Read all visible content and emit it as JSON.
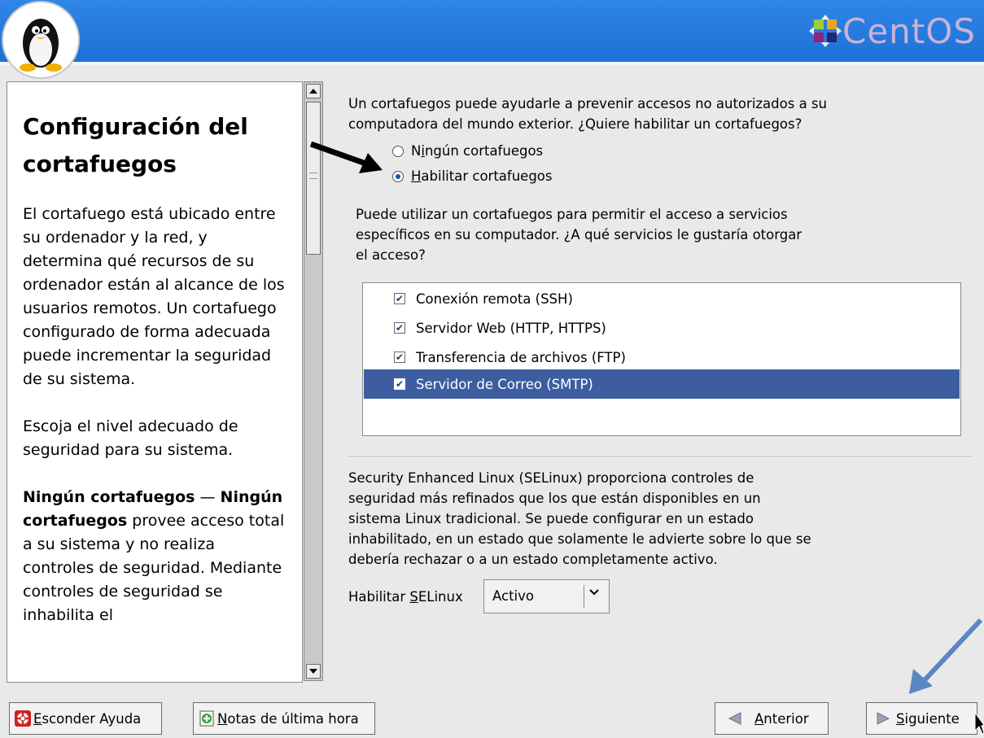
{
  "header": {
    "logo_text": "CentOS"
  },
  "help": {
    "title": "Configuración del cortafuegos",
    "p1": "El cortafuego está ubicado entre su ordenador y la red, y determina qué recursos de su ordenador están al alcance de los usuarios remotos. Un cortafuego configurado de forma adecuada puede incrementar la seguridad de su sistema.",
    "p2": "Escoja el nivel adecuado de seguridad para su sistema.",
    "p3_bold1": "Ningún cortafuegos",
    "p3_dash": " —",
    "p3_bold2": "Ningún cortafuegos",
    "p3_rest": " provee acceso total a su sistema y no realiza controles de seguridad. Mediante controles de seguridad se inhabilita el"
  },
  "firewall": {
    "intro_line1": "Un cortafuegos puede ayudarle a prevenir accesos no autorizados a su",
    "intro_line2": "computadora del mundo exterior. ¿Quiere habilitar un cortafuegos?",
    "option_none_pre": "N",
    "option_none_key": "i",
    "option_none_post": "ngún cortafuegos",
    "option_enable_key": "H",
    "option_enable_post": "abilitar cortafuegos",
    "selected": "enable"
  },
  "services": {
    "intro_line1": "Puede utilizar un cortafuegos para permitir el acceso a servicios",
    "intro_line2": "específicos en su computador. ¿A qué servicios le gustaría otorgar",
    "intro_line3": "el acceso?",
    "items": [
      {
        "label": "Conexión remota (SSH)",
        "checked": true
      },
      {
        "label": "Servidor Web (HTTP, HTTPS)",
        "checked": true
      },
      {
        "label": "Transferencia de archivos (FTP)",
        "checked": true
      },
      {
        "label": "Servidor de Correo (SMTP)",
        "checked": true
      }
    ],
    "selected_index": 3
  },
  "selinux": {
    "line1": "Security Enhanced Linux (SELinux) proporciona controles de",
    "line2": "seguridad más refinados que los que están disponibles en un",
    "line3": "sistema Linux tradicional. Se puede configurar en un estado",
    "line4": "inhabilitado, en un estado que solamente le advierte sobre lo que se",
    "line5": "debería rechazar o a un estado completamente activo.",
    "label_pre": "Habilitar ",
    "label_key": "S",
    "label_post": "ELinux",
    "value": "Activo"
  },
  "buttons": {
    "hide_help_key": "E",
    "hide_help_post": "sconder Ayuda",
    "release_notes_key": "N",
    "release_notes_post": "otas de última hora",
    "back_key": "A",
    "back_post": "nterior",
    "next_key": "S",
    "next_post": "iguiente"
  },
  "colors": {
    "header_blue": "#1d70d6",
    "selection": "#3c5ea1",
    "annotation_arrow_black": "#000000",
    "annotation_arrow_blue": "#5b86c4"
  }
}
